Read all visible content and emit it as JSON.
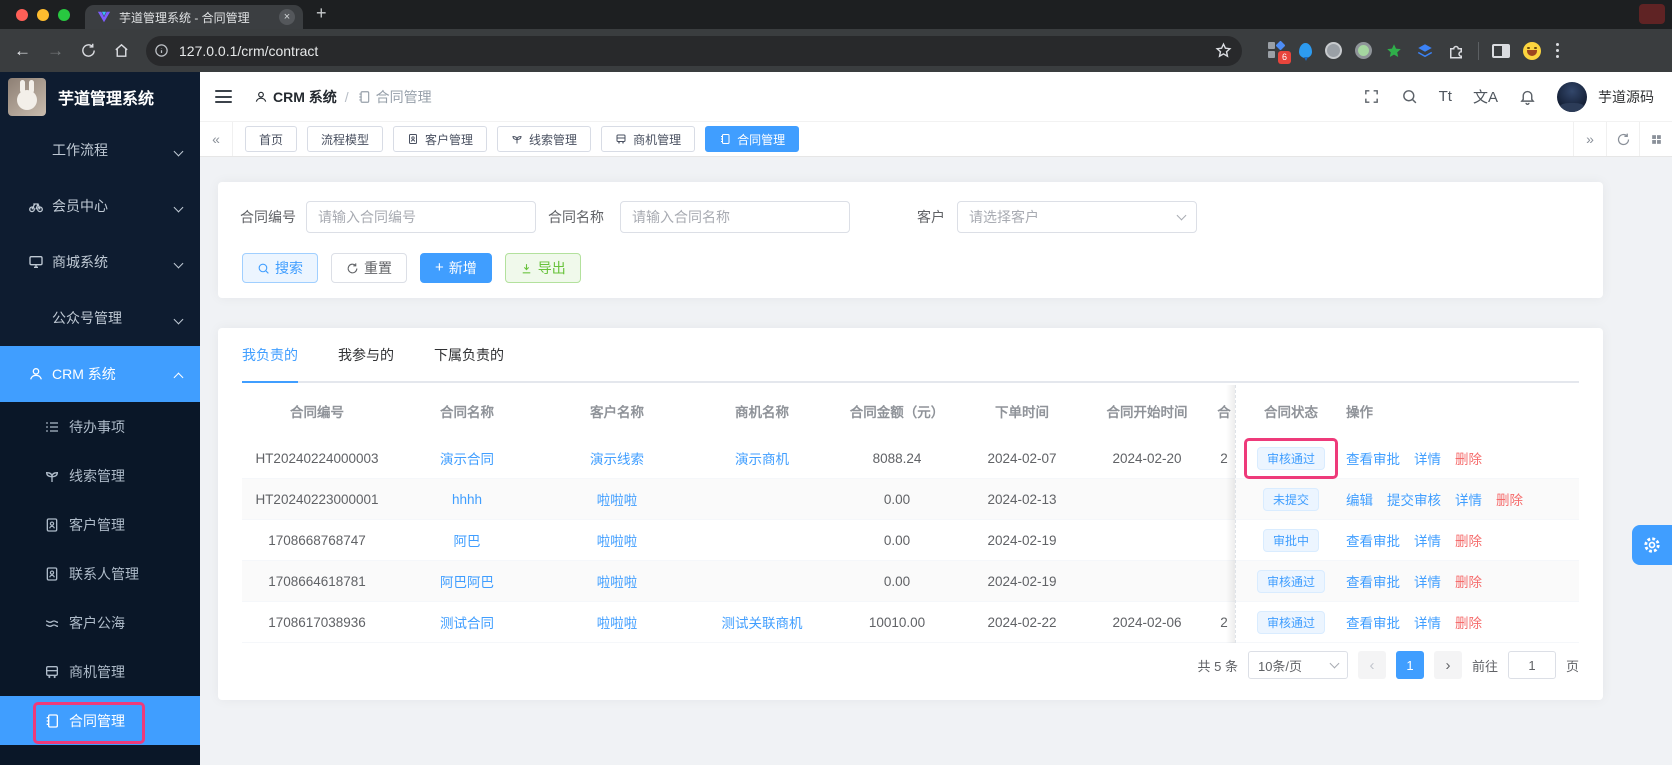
{
  "colors": {
    "accent": "#409eff",
    "danger": "#f56c6c",
    "success": "#67c23a",
    "highlight_ring": "#ee3a7a",
    "sidebar_bg": "#0e1c30",
    "status_tag_bg": "#ecf5ff"
  },
  "browser": {
    "tab_title": "芋道管理系统 - 合同管理",
    "close_icon": "×",
    "new_tab_icon": "+",
    "back_icon": "←",
    "forward_icon": "→",
    "url": "127.0.0.1/crm/contract",
    "ext_badge_count": "6"
  },
  "sidebar": {
    "logo_title": "芋道管理系统",
    "items": [
      {
        "label": "工作流程"
      },
      {
        "label": "会员中心"
      },
      {
        "label": "商城系统"
      },
      {
        "label": "公众号管理"
      },
      {
        "label": "CRM 系统"
      }
    ],
    "crm_children": [
      {
        "label": "待办事项"
      },
      {
        "label": "线索管理"
      },
      {
        "label": "客户管理"
      },
      {
        "label": "联系人管理"
      },
      {
        "label": "客户公海"
      },
      {
        "label": "商机管理"
      },
      {
        "label": "合同管理"
      }
    ]
  },
  "header": {
    "breadcrumb_root": "CRM 系统",
    "breadcrumb_sep": "/",
    "breadcrumb_current": "合同管理",
    "font_icon": "Tt",
    "lang_icon": "文A",
    "username": "芋道源码"
  },
  "tabbar": {
    "collapse_icon": "«",
    "expand_icon": "»",
    "tabs": [
      {
        "label": "首页"
      },
      {
        "label": "流程模型"
      },
      {
        "label": "客户管理"
      },
      {
        "label": "线索管理"
      },
      {
        "label": "商机管理"
      },
      {
        "label": "合同管理"
      }
    ]
  },
  "search": {
    "contract_no_label": "合同编号",
    "contract_no_placeholder": "请输入合同编号",
    "contract_name_label": "合同名称",
    "contract_name_placeholder": "请输入合同名称",
    "customer_label": "客户",
    "customer_placeholder": "请选择客户",
    "search_btn": "搜索",
    "reset_btn": "重置",
    "add_btn": "新增",
    "export_btn": "导出"
  },
  "panel": {
    "tabs": [
      {
        "label": "我负责的"
      },
      {
        "label": "我参与的"
      },
      {
        "label": "下属负责的"
      }
    ],
    "columns": [
      "合同编号",
      "合同名称",
      "客户名称",
      "商机名称",
      "合同金额（元）",
      "下单时间",
      "合同开始时间",
      "合",
      "合同状态",
      "操作"
    ],
    "rows": [
      {
        "no": "HT20240224000003",
        "name": "演示合同",
        "customer": "演示线索",
        "business": "演示商机",
        "amount": "8088.24",
        "order_time": "2024-02-07",
        "start_time": "2024-02-20",
        "end_clip": "2",
        "status": "审核通过",
        "actions": [
          {
            "label": "查看审批"
          },
          {
            "label": "详情"
          },
          {
            "label": "删除"
          }
        ]
      },
      {
        "no": "HT20240223000001",
        "name": "hhhh",
        "customer": "啦啦啦",
        "business": "",
        "amount": "0.00",
        "order_time": "2024-02-13",
        "start_time": "",
        "end_clip": "",
        "status": "未提交",
        "actions": [
          {
            "label": "编辑"
          },
          {
            "label": "提交审核"
          },
          {
            "label": "详情"
          },
          {
            "label": "删除"
          }
        ]
      },
      {
        "no": "1708668768747",
        "name": "阿巴",
        "customer": "啦啦啦",
        "business": "",
        "amount": "0.00",
        "order_time": "2024-02-19",
        "start_time": "",
        "end_clip": "",
        "status": "审批中",
        "actions": [
          {
            "label": "查看审批"
          },
          {
            "label": "详情"
          },
          {
            "label": "删除"
          }
        ]
      },
      {
        "no": "1708664618781",
        "name": "阿巴阿巴",
        "customer": "啦啦啦",
        "business": "",
        "amount": "0.00",
        "order_time": "2024-02-19",
        "start_time": "",
        "end_clip": "",
        "status": "审核通过",
        "actions": [
          {
            "label": "查看审批"
          },
          {
            "label": "详情"
          },
          {
            "label": "删除"
          }
        ]
      },
      {
        "no": "1708617038936",
        "name": "测试合同",
        "customer": "啦啦啦",
        "business": "测试关联商机",
        "amount": "10010.00",
        "order_time": "2024-02-22",
        "start_time": "2024-02-06",
        "end_clip": "2",
        "status": "审核通过",
        "actions": [
          {
            "label": "查看审批"
          },
          {
            "label": "详情"
          },
          {
            "label": "删除"
          }
        ]
      }
    ],
    "pagination": {
      "total": "共 5 条",
      "page_size": "10条/页",
      "current_page": "1",
      "goto_label": "前往",
      "goto_value": "1",
      "page_unit": "页"
    }
  }
}
